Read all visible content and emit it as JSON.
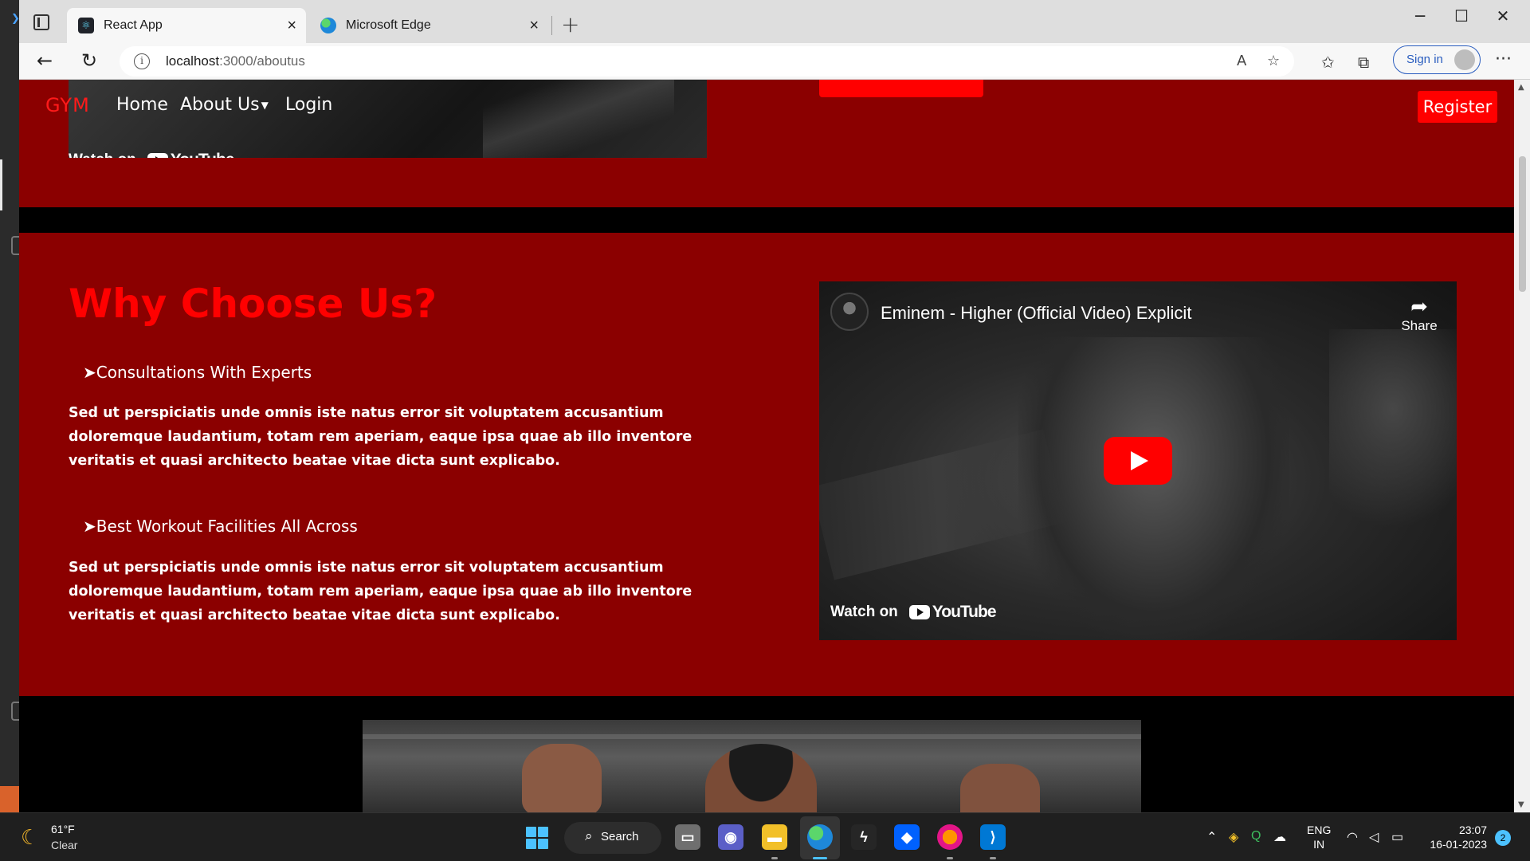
{
  "browser": {
    "tabs": [
      {
        "title": "React App",
        "favicon": "react-icon",
        "active": true
      },
      {
        "title": "Microsoft Edge",
        "favicon": "edge-icon",
        "active": false
      }
    ],
    "url_host": "localhost",
    "url_path": ":3000/aboutus",
    "sign_in_label": "Sign in",
    "window_controls": {
      "minimize": "─",
      "maximize": "☐",
      "close": "✕"
    },
    "new_tab": "+",
    "menu": "···"
  },
  "navbar": {
    "brand": "GYM",
    "links": [
      {
        "label": "Home"
      },
      {
        "label": "About Us",
        "dropdown": true
      },
      {
        "label": "Login"
      }
    ],
    "register_label": "Register",
    "colors": {
      "accent": "#ff0000",
      "page_bg": "#8b0000"
    }
  },
  "top_video": {
    "watch_on": "Watch on",
    "youtube": "YouTube"
  },
  "why_section": {
    "title": "Why Choose Us?",
    "features": [
      {
        "heading": "➤Consultations With Experts",
        "body": "Sed ut perspiciatis unde omnis iste natus error sit voluptatem accusantium doloremque laudantium, totam rem aperiam, eaque ipsa quae ab illo inventore veritatis et quasi architecto beatae vitae dicta sunt explicabo."
      },
      {
        "heading": "➤Best Workout Facilities All Across",
        "body": "Sed ut perspiciatis unde omnis iste natus error sit voluptatem accusantium doloremque laudantium, totam rem aperiam, eaque ipsa quae ab illo inventore veritatis et quasi architecto beatae vitae dicta sunt explicabo."
      }
    ],
    "video": {
      "title": "Eminem - Higher (Official Video) Explicit",
      "share_label": "Share",
      "watch_on": "Watch on",
      "youtube": "YouTube"
    }
  },
  "taskbar": {
    "weather_temp": "61°F",
    "weather_desc": "Clear",
    "search_label": "Search",
    "language_top": "ENG",
    "language_bottom": "IN",
    "time": "23:07",
    "date": "16-01-2023",
    "notification_count": "2"
  }
}
